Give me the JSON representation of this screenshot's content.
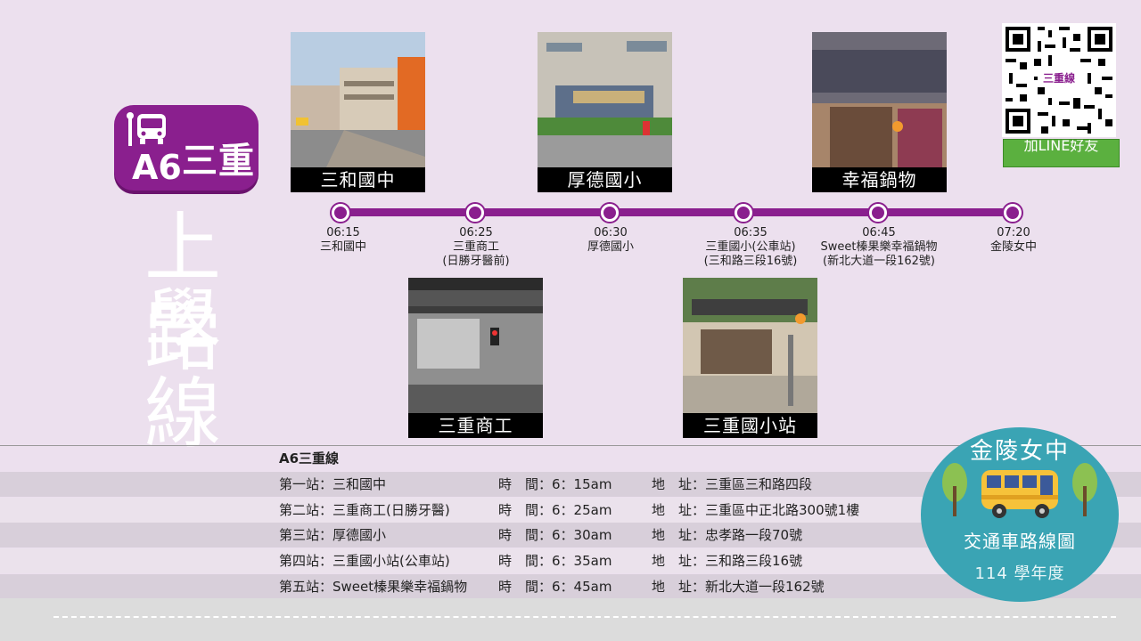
{
  "route": {
    "code": "A6",
    "name": "三重",
    "title_line1": "上學",
    "title_line2": "路線"
  },
  "photos": [
    {
      "caption": "三和國中"
    },
    {
      "caption": "厚德國小"
    },
    {
      "caption": "幸福鍋物"
    },
    {
      "caption": "三重商工"
    },
    {
      "caption": "三重國小站"
    }
  ],
  "stops": [
    {
      "time": "06:15",
      "name": "三和國中",
      "name2": ""
    },
    {
      "time": "06:25",
      "name": "三重商工",
      "name2": "(日勝牙醫前)"
    },
    {
      "time": "06:30",
      "name": "厚德國小",
      "name2": ""
    },
    {
      "time": "06:35",
      "name": "三重國小(公車站)",
      "name2": "(三和路三段16號)"
    },
    {
      "time": "06:45",
      "name": "Sweet榛果樂幸福鍋物",
      "name2": "(新北大道一段162號)"
    },
    {
      "time": "07:20",
      "name": "金陵女中",
      "name2": ""
    }
  ],
  "qr": {
    "badge": "三重線",
    "button": "加LINE好友"
  },
  "table": {
    "title": "A6三重線",
    "rows": [
      {
        "stop": "第一站：三和國中",
        "time": "時　間：6：15am",
        "addr": "地　址：三重區三和路四段"
      },
      {
        "stop": "第二站：三重商工(日勝牙醫)",
        "time": "時　間：6：25am",
        "addr": "地　址：三重區中正北路300號1樓"
      },
      {
        "stop": "第三站：厚德國小",
        "time": "時　間：6：30am",
        "addr": "地　址：忠孝路一段70號"
      },
      {
        "stop": "第四站：三重國小站(公車站)",
        "time": "時　間：6：35am",
        "addr": "地　址：三和路三段16號"
      },
      {
        "stop": "第五站：Sweet榛果樂幸福鍋物",
        "time": "時　間：6：45am",
        "addr": "地　址：新北大道一段162號"
      }
    ]
  },
  "logo": {
    "school": "金陵女中",
    "subtitle": "交通車路線圖",
    "year": "114 學年度"
  },
  "colors": {
    "accent": "#8a1f8e",
    "background": "#ece0ee",
    "logo": "#3aa4b4",
    "line_button": "#5bb03f"
  }
}
